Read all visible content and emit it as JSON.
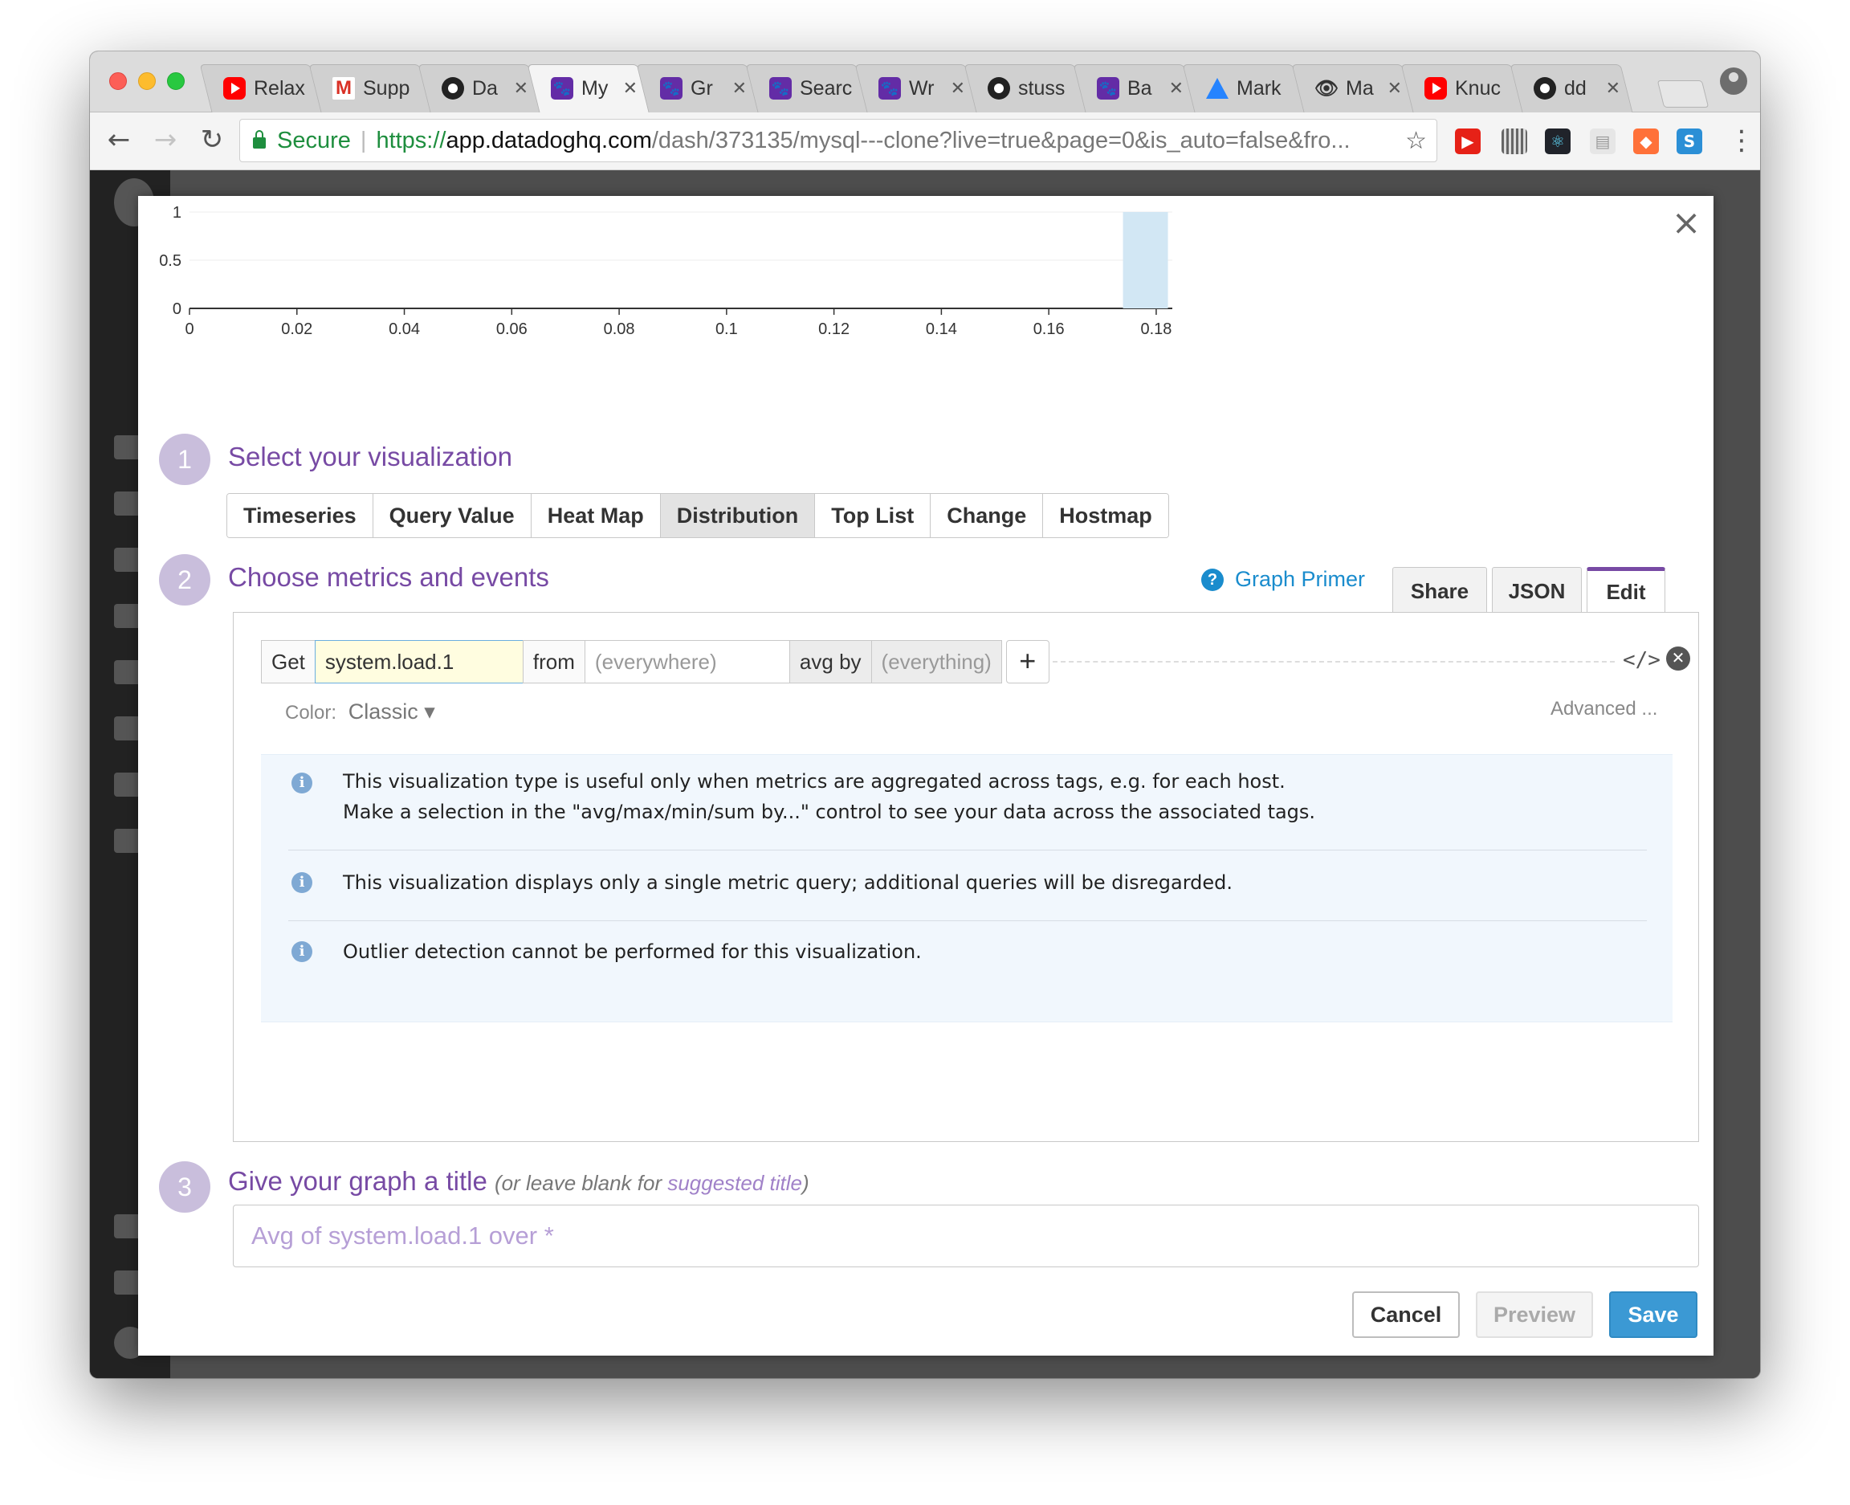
{
  "browser": {
    "tabs": [
      {
        "title": "Relax",
        "favicon": "youtube-icon",
        "active": false
      },
      {
        "title": "Supp",
        "favicon": "gmail-icon",
        "active": false
      },
      {
        "title": "Da",
        "favicon": "github-icon",
        "active": false
      },
      {
        "title": "My",
        "favicon": "datadog-icon",
        "active": true
      },
      {
        "title": "Gr",
        "favicon": "datadog-icon",
        "active": false
      },
      {
        "title": "Searc",
        "favicon": "datadog-icon",
        "active": false
      },
      {
        "title": "Wr",
        "favicon": "datadog-icon",
        "active": false
      },
      {
        "title": "stuss",
        "favicon": "github-icon",
        "active": false
      },
      {
        "title": "Ba",
        "favicon": "datadog-icon",
        "active": false
      },
      {
        "title": "Mark",
        "favicon": "atlassian-icon",
        "active": false
      },
      {
        "title": "Ma",
        "favicon": "eye-icon",
        "active": false
      },
      {
        "title": "Knuc",
        "favicon": "youtube-icon",
        "active": false
      },
      {
        "title": "dd",
        "favicon": "github-icon",
        "active": false
      }
    ],
    "omnibox": {
      "secure_label": "Secure",
      "url_scheme": "https://",
      "url_host": "app.datadoghq.com",
      "url_path": "/dash/373135/mysql---clone?live=true&page=0&is_auto=false&fro..."
    },
    "extensions": [
      "youtube-ext-icon",
      "barcode-ext-icon",
      "react-ext-icon",
      "doc-ext-icon",
      "fox-ext-icon",
      "s-ext-icon"
    ]
  },
  "modal": {
    "graph": {
      "y_ticks": [
        "1",
        "0.5",
        "0"
      ],
      "x_ticks": [
        "0",
        "0.02",
        "0.04",
        "0.06",
        "0.08",
        "0.1",
        "0.12",
        "0.14",
        "0.16",
        "0.18"
      ]
    },
    "step1": {
      "number": "1",
      "title": "Select your visualization",
      "options": [
        "Timeseries",
        "Query Value",
        "Heat Map",
        "Distribution",
        "Top List",
        "Change",
        "Hostmap"
      ],
      "selected": "Distribution"
    },
    "step2": {
      "number": "2",
      "title": "Choose metrics and events",
      "graph_primer": "Graph Primer",
      "tabs": {
        "share": "Share",
        "json": "JSON",
        "edit": "Edit"
      },
      "query": {
        "get_label": "Get",
        "metric": "system.load.1",
        "from_label": "from",
        "from_value": "(everywhere)",
        "by_label": "avg by",
        "by_value": "(everything)",
        "add": "+"
      },
      "color_label": "Color:",
      "color_value": "Classic ▾",
      "advanced": "Advanced ...",
      "info": [
        {
          "line1": "This visualization type is useful only when metrics are aggregated across tags, e.g. for each host.",
          "line2": "Make a selection in the \"avg/max/min/sum by...\" control to see your data across the associated tags."
        },
        {
          "line1": "This visualization displays only a single metric query; additional queries will be disregarded."
        },
        {
          "line1": "Outlier detection cannot be performed for this visualization."
        }
      ]
    },
    "step3": {
      "number": "3",
      "title": "Give your graph a title",
      "hint_prefix": "(or leave blank for ",
      "hint_link": "suggested title",
      "hint_suffix": ")",
      "placeholder": "Avg of system.load.1 over *"
    },
    "buttons": {
      "cancel": "Cancel",
      "preview": "Preview",
      "save": "Save"
    }
  },
  "chart_data": {
    "type": "bar",
    "x": [
      0.178
    ],
    "values": [
      1
    ],
    "xlim": [
      0,
      0.183
    ],
    "ylim": [
      0,
      1
    ],
    "grid": true,
    "color": "#d2e7f4"
  }
}
